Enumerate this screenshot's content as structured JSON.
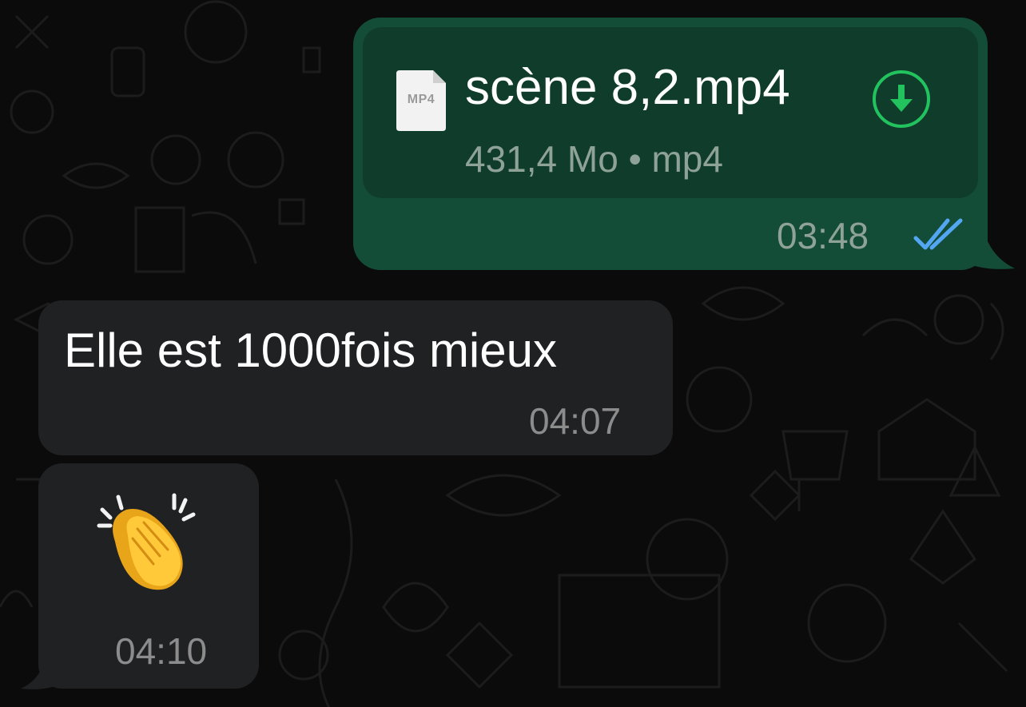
{
  "outgoing_message": {
    "file_type_label": "MP4",
    "file_name": "scène 8,2.mp4",
    "file_meta": "431,4 Mo • mp4",
    "time": "03:48",
    "status_icon": "double-check-read-icon",
    "download_icon": "download-arrow-circle-icon"
  },
  "incoming_messages": [
    {
      "text": "Elle est 1000fois mieux",
      "time": "04:07"
    },
    {
      "emoji_icon": "clapping-hands-icon",
      "time": "04:10"
    }
  ],
  "colors": {
    "outgoing_bubble": "#144d37",
    "file_card": "#103d2b",
    "incoming_bubble": "#202123",
    "read_check": "#53a6f2",
    "download_green": "#22c35e",
    "background": "#0b0b0b"
  }
}
